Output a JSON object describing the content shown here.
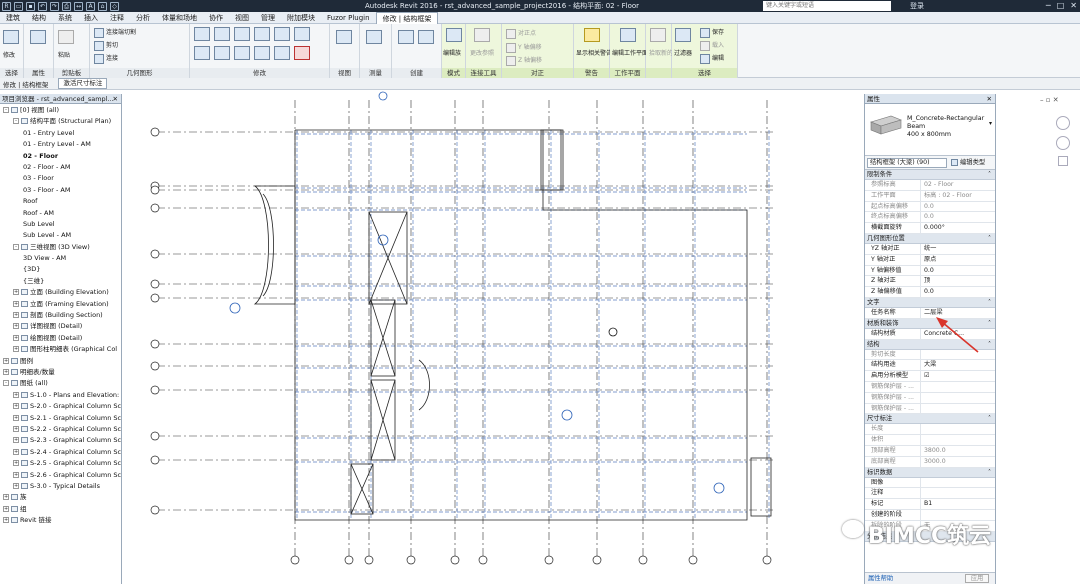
{
  "titlebar": {
    "title": "Autodesk Revit 2016 -  rst_advanced_sample_project2016 - 结构平面: 02 - Floor",
    "search_placeholder": "键入关键字或短语",
    "login": "登录",
    "win_min": "─",
    "win_max": "□",
    "win_close": "✕"
  },
  "menu": {
    "items": [
      "建筑",
      "结构",
      "系统",
      "插入",
      "注释",
      "分析",
      "体量和场地",
      "协作",
      "视图",
      "管理",
      "附加模块",
      "Fuzor Plugin",
      "修改 | 结构框架"
    ],
    "active_index": 12
  },
  "ribbon": {
    "panels": [
      {
        "label": "选择",
        "tools": [
          "修改"
        ]
      },
      {
        "label": "属性",
        "tools": []
      },
      {
        "label": "剪贴板",
        "tools": [
          "粘贴"
        ]
      },
      {
        "label": "几何图形",
        "tools": [
          "连接端切割",
          "剪切",
          "连接"
        ]
      },
      {
        "label": "修改",
        "tools": []
      },
      {
        "label": "视图",
        "tools": []
      },
      {
        "label": "测量",
        "tools": []
      },
      {
        "label": "创建",
        "tools": []
      },
      {
        "label": "模式",
        "tools": [
          "编辑族"
        ]
      },
      {
        "label": "连接工具",
        "tools": [
          "更改参照"
        ]
      },
      {
        "label": "对正",
        "tools": [
          "对正点",
          "Y 轴偏移",
          "Z 轴偏移"
        ]
      },
      {
        "label": "警告",
        "tools": [
          "显示相关警告"
        ]
      },
      {
        "label": "工作平面",
        "tools": [
          "编辑工作平面"
        ]
      },
      {
        "label": "",
        "tools": [
          "拾取新的"
        ]
      },
      {
        "label": "选择",
        "tools": [
          "过滤器",
          "保存",
          "载入",
          "编辑"
        ]
      }
    ]
  },
  "options_bar": {
    "context": "修改 | 结构框架",
    "button": "激活尺寸标注"
  },
  "project_browser": {
    "title": "项目浏览器 - rst_advanced_sampl...",
    "close": "✕",
    "nodes": [
      {
        "level": 0,
        "expand": "-",
        "text": "[0] 视图 (all)"
      },
      {
        "level": 1,
        "expand": "-",
        "text": "结构平面 (Structural Plan)"
      },
      {
        "level": 2,
        "expand": "",
        "text": "01 - Entry Level"
      },
      {
        "level": 2,
        "expand": "",
        "text": "01 - Entry Level - AM"
      },
      {
        "level": 2,
        "expand": "",
        "text": "02 - Floor",
        "bold": true
      },
      {
        "level": 2,
        "expand": "",
        "text": "02 - Floor - AM"
      },
      {
        "level": 2,
        "expand": "",
        "text": "03 - Floor"
      },
      {
        "level": 2,
        "expand": "",
        "text": "03 - Floor - AM"
      },
      {
        "level": 2,
        "expand": "",
        "text": "Roof"
      },
      {
        "level": 2,
        "expand": "",
        "text": "Roof - AM"
      },
      {
        "level": 2,
        "expand": "",
        "text": "Sub Level"
      },
      {
        "level": 2,
        "expand": "",
        "text": "Sub Level - AM"
      },
      {
        "level": 1,
        "expand": "-",
        "text": "三维视图 (3D View)"
      },
      {
        "level": 2,
        "expand": "",
        "text": "3D View - AM"
      },
      {
        "level": 2,
        "expand": "",
        "text": "{3D}"
      },
      {
        "level": 2,
        "expand": "",
        "text": "{三维}"
      },
      {
        "level": 1,
        "expand": "+",
        "text": "立面 (Building Elevation)"
      },
      {
        "level": 1,
        "expand": "+",
        "text": "立面 (Framing Elevation)"
      },
      {
        "level": 1,
        "expand": "+",
        "text": "剖面 (Building Section)"
      },
      {
        "level": 1,
        "expand": "+",
        "text": "详图视图 (Detail)"
      },
      {
        "level": 1,
        "expand": "+",
        "text": "绘图视图 (Detail)"
      },
      {
        "level": 1,
        "expand": "+",
        "text": "图形柱明细表 (Graphical Col"
      },
      {
        "level": 0,
        "expand": "+",
        "text": "图例"
      },
      {
        "level": 0,
        "expand": "+",
        "text": "明细表/数量"
      },
      {
        "level": 0,
        "expand": "-",
        "text": "图纸 (all)"
      },
      {
        "level": 1,
        "expand": "+",
        "text": "S-1.0 - Plans and Elevation:"
      },
      {
        "level": 1,
        "expand": "+",
        "text": "S-2.0 - Graphical Column Sc"
      },
      {
        "level": 1,
        "expand": "+",
        "text": "S-2.1 - Graphical Column Sc"
      },
      {
        "level": 1,
        "expand": "+",
        "text": "S-2.2 - Graphical Column Sc"
      },
      {
        "level": 1,
        "expand": "+",
        "text": "S-2.3 - Graphical Column Sc"
      },
      {
        "level": 1,
        "expand": "+",
        "text": "S-2.4 - Graphical Column Sc"
      },
      {
        "level": 1,
        "expand": "+",
        "text": "S-2.5 - Graphical Column Sc"
      },
      {
        "level": 1,
        "expand": "+",
        "text": "S-2.6 - Graphical Column Sc"
      },
      {
        "level": 1,
        "expand": "+",
        "text": "S-3.0 - Typical Details"
      },
      {
        "level": 0,
        "expand": "+",
        "text": "族"
      },
      {
        "level": 0,
        "expand": "+",
        "text": "组"
      },
      {
        "level": 0,
        "expand": "+",
        "text": "Revit 链接"
      }
    ]
  },
  "properties": {
    "title": "属性",
    "close": "✕",
    "type_name": "M_Concrete-Rectangular Beam",
    "type_size": "400 x 800mm",
    "instance_filter": "结构框架 (大梁) (90)",
    "edit_type": "编辑类型",
    "sections": [
      {
        "name": "限制条件",
        "rows": [
          {
            "k": "参照标高",
            "v": "02 - Floor",
            "dis": true
          },
          {
            "k": "工作平面",
            "v": "标高 : 02 - Floor",
            "dis": true
          },
          {
            "k": "起点标高偏移",
            "v": "0.0",
            "dis": true
          },
          {
            "k": "终点标高偏移",
            "v": "0.0",
            "dis": true
          },
          {
            "k": "横截面旋转",
            "v": "0.000°",
            "dis": false
          }
        ]
      },
      {
        "name": "几何图形位置",
        "rows": [
          {
            "k": "YZ 轴对正",
            "v": "统一",
            "dis": false
          },
          {
            "k": "Y 轴对正",
            "v": "原点",
            "dis": false
          },
          {
            "k": "Y 轴偏移值",
            "v": "0.0",
            "dis": false
          },
          {
            "k": "Z 轴对正",
            "v": "顶",
            "dis": false
          },
          {
            "k": "Z 轴偏移值",
            "v": "0.0",
            "dis": false
          }
        ]
      },
      {
        "name": "文字",
        "rows": [
          {
            "k": "任务名称",
            "v": "二层梁",
            "dis": false
          }
        ]
      },
      {
        "name": "材质和装饰",
        "rows": [
          {
            "k": "结构材质",
            "v": "Concrete C...",
            "dis": false
          }
        ]
      },
      {
        "name": "结构",
        "rows": [
          {
            "k": "剪切长度",
            "v": "",
            "dis": true
          },
          {
            "k": "结构用途",
            "v": "大梁",
            "dis": false
          },
          {
            "k": "启用分析模型",
            "v": "☑",
            "dis": false
          },
          {
            "k": "钢筋保护层 - ...",
            "v": "",
            "dis": true
          },
          {
            "k": "钢筋保护层 - ...",
            "v": "",
            "dis": true
          },
          {
            "k": "钢筋保护层 - ...",
            "v": "",
            "dis": true
          }
        ]
      },
      {
        "name": "尺寸标注",
        "rows": [
          {
            "k": "长度",
            "v": "",
            "dis": true
          },
          {
            "k": "体积",
            "v": "",
            "dis": true
          },
          {
            "k": "顶部高程",
            "v": "3800.0",
            "dis": true
          },
          {
            "k": "底部高程",
            "v": "3000.0",
            "dis": true
          }
        ]
      },
      {
        "name": "标识数据",
        "rows": [
          {
            "k": "图像",
            "v": "",
            "dis": false
          },
          {
            "k": "注释",
            "v": "",
            "dis": false
          },
          {
            "k": "标记",
            "v": "B1",
            "dis": false
          },
          {
            "k": "创建的阶段",
            "v": "",
            "dis": false
          },
          {
            "k": "拆除的阶段",
            "v": "无",
            "dis": true
          }
        ]
      },
      {
        "name": "分析结果",
        "rows": []
      }
    ],
    "help": "属性帮助",
    "apply": "应用"
  },
  "watermark": "BIMCC筑云",
  "colors": {
    "grid": "#222222",
    "beam": "#4a6fb5",
    "accent": "#d9342b",
    "ribbon_ctx": "#eef7dc"
  }
}
